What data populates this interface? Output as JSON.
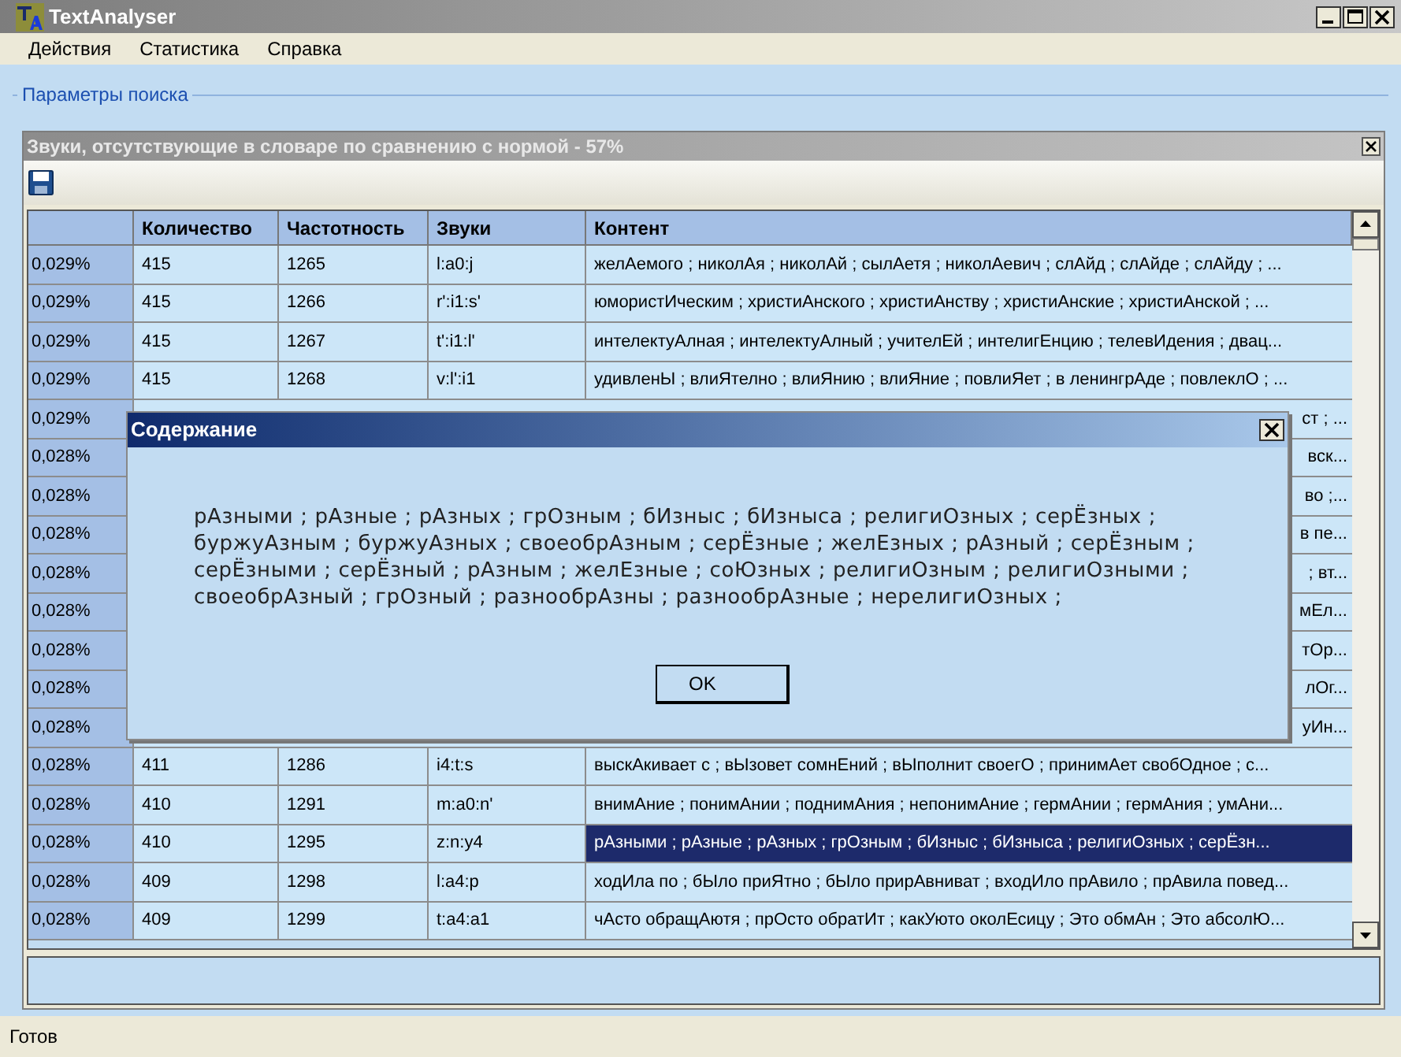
{
  "window": {
    "title": "TextAnalyser"
  },
  "menu": [
    "Действия",
    "Статистика",
    "Справка"
  ],
  "group_box": {
    "legend": "Параметры поиска"
  },
  "panel": {
    "title": "Звуки, отсутствующие в словаре по сравнению с нормой - 57%"
  },
  "table": {
    "columns": [
      "Количество",
      "Частотность",
      "Звуки",
      "Контент"
    ],
    "rows": [
      {
        "kind": "full",
        "header": "0,029%",
        "count": "415",
        "frequency": "1265",
        "sounds": "l:a0:j",
        "content": "желАемого ; николАя ; николАй ; сылАетя ; николАевич ; слАйд ; слАйде ; слАйду ; ...",
        "selected": false
      },
      {
        "kind": "full",
        "header": "0,029%",
        "count": "415",
        "frequency": "1266",
        "sounds": "r':i1:s'",
        "content": "юмористИческим ; христиАнского ; христиАнству ; христиАнские ; христиАнской ; ...",
        "selected": false
      },
      {
        "kind": "full",
        "header": "0,029%",
        "count": "415",
        "frequency": "1267",
        "sounds": "t':i1:l'",
        "content": "интелектуАлная ; интелектуАлный ; учителЕй ; интелигЕнцию ; телевИдения ; двац...",
        "selected": false
      },
      {
        "kind": "full",
        "header": "0,029%",
        "count": "415",
        "frequency": "1268",
        "sounds": "v:l':i1",
        "content": "удивленЫ ; влиЯтелно ; влиЯнию ; влиЯние ; повлиЯет ; в ленингрАде ; повлеклО ; ...",
        "selected": false
      },
      {
        "kind": "covered",
        "header": "0,029%",
        "content": "ст ; ..."
      },
      {
        "kind": "covered",
        "header": "0,028%",
        "content": "вск..."
      },
      {
        "kind": "covered",
        "header": "0,028%",
        "content": "во ;..."
      },
      {
        "kind": "covered",
        "header": "0,028%",
        "content": "в пе..."
      },
      {
        "kind": "covered",
        "header": "0,028%",
        "content": "; вт..."
      },
      {
        "kind": "covered",
        "header": "0,028%",
        "content": "мЕл..."
      },
      {
        "kind": "covered",
        "header": "0,028%",
        "content": "тОр..."
      },
      {
        "kind": "covered",
        "header": "0,028%",
        "content": "лОг..."
      },
      {
        "kind": "covered",
        "header": "0,028%",
        "content": "уИн..."
      },
      {
        "kind": "full",
        "header": "0,028%",
        "count": "411",
        "frequency": "1286",
        "sounds": "i4:t:s",
        "content": "выскАкивает с ; вЫзовет сомнЕний ; вЫполнит своегО ; принимАет свобОдное ; с...",
        "selected": false
      },
      {
        "kind": "full",
        "header": "0,028%",
        "count": "410",
        "frequency": "1291",
        "sounds": "m:a0:n'",
        "content": "внимАние ; понимАнии ; поднимАния ; непонимАние ; гермАнии ; гермАния ; умАни...",
        "selected": false
      },
      {
        "kind": "full",
        "header": "0,028%",
        "count": "410",
        "frequency": "1295",
        "sounds": "z:n:y4",
        "content": "рАзными ; рАзные ; рАзных ; грОзным ; бИзныс ; бИзныса ; религиОзных ; серЁзн...",
        "selected": true
      },
      {
        "kind": "full",
        "header": "0,028%",
        "count": "409",
        "frequency": "1298",
        "sounds": "l:a4:p",
        "content": "ходИла по ; бЫло приЯтно ; бЫло прирАвниват ; входИло прАвило ; прАвила повед...",
        "selected": false
      },
      {
        "kind": "full",
        "header": "0,028%",
        "count": "409",
        "frequency": "1299",
        "sounds": "t:a4:a1",
        "content": "чАсто обращАютя ; прОсто обратИт ; какУюто околЕсицу ; Это обмАн ; Это абсолЮ...",
        "selected": false
      }
    ]
  },
  "dialog": {
    "title": "Содержание",
    "text": "рАзными ; рАзные ; рАзных ; грОзным ; бИзныс ; бИзныса ; религиОзных ; серЁзных ; буржуАзным ; буржуАзных ; своеобрАзным ; серЁзные ; желЕзных ; рАзный ; серЁзным ; серЁзными ; серЁзный ; рАзным ; желЕзные ; соЮзных ; религиОзным ; религиОзными ; своеобрАзный ; грОзный ; разнообрАзны ; разнообрАзные ; нерелигиОзных ;",
    "button": "OK"
  },
  "status_bar": "Готов"
}
